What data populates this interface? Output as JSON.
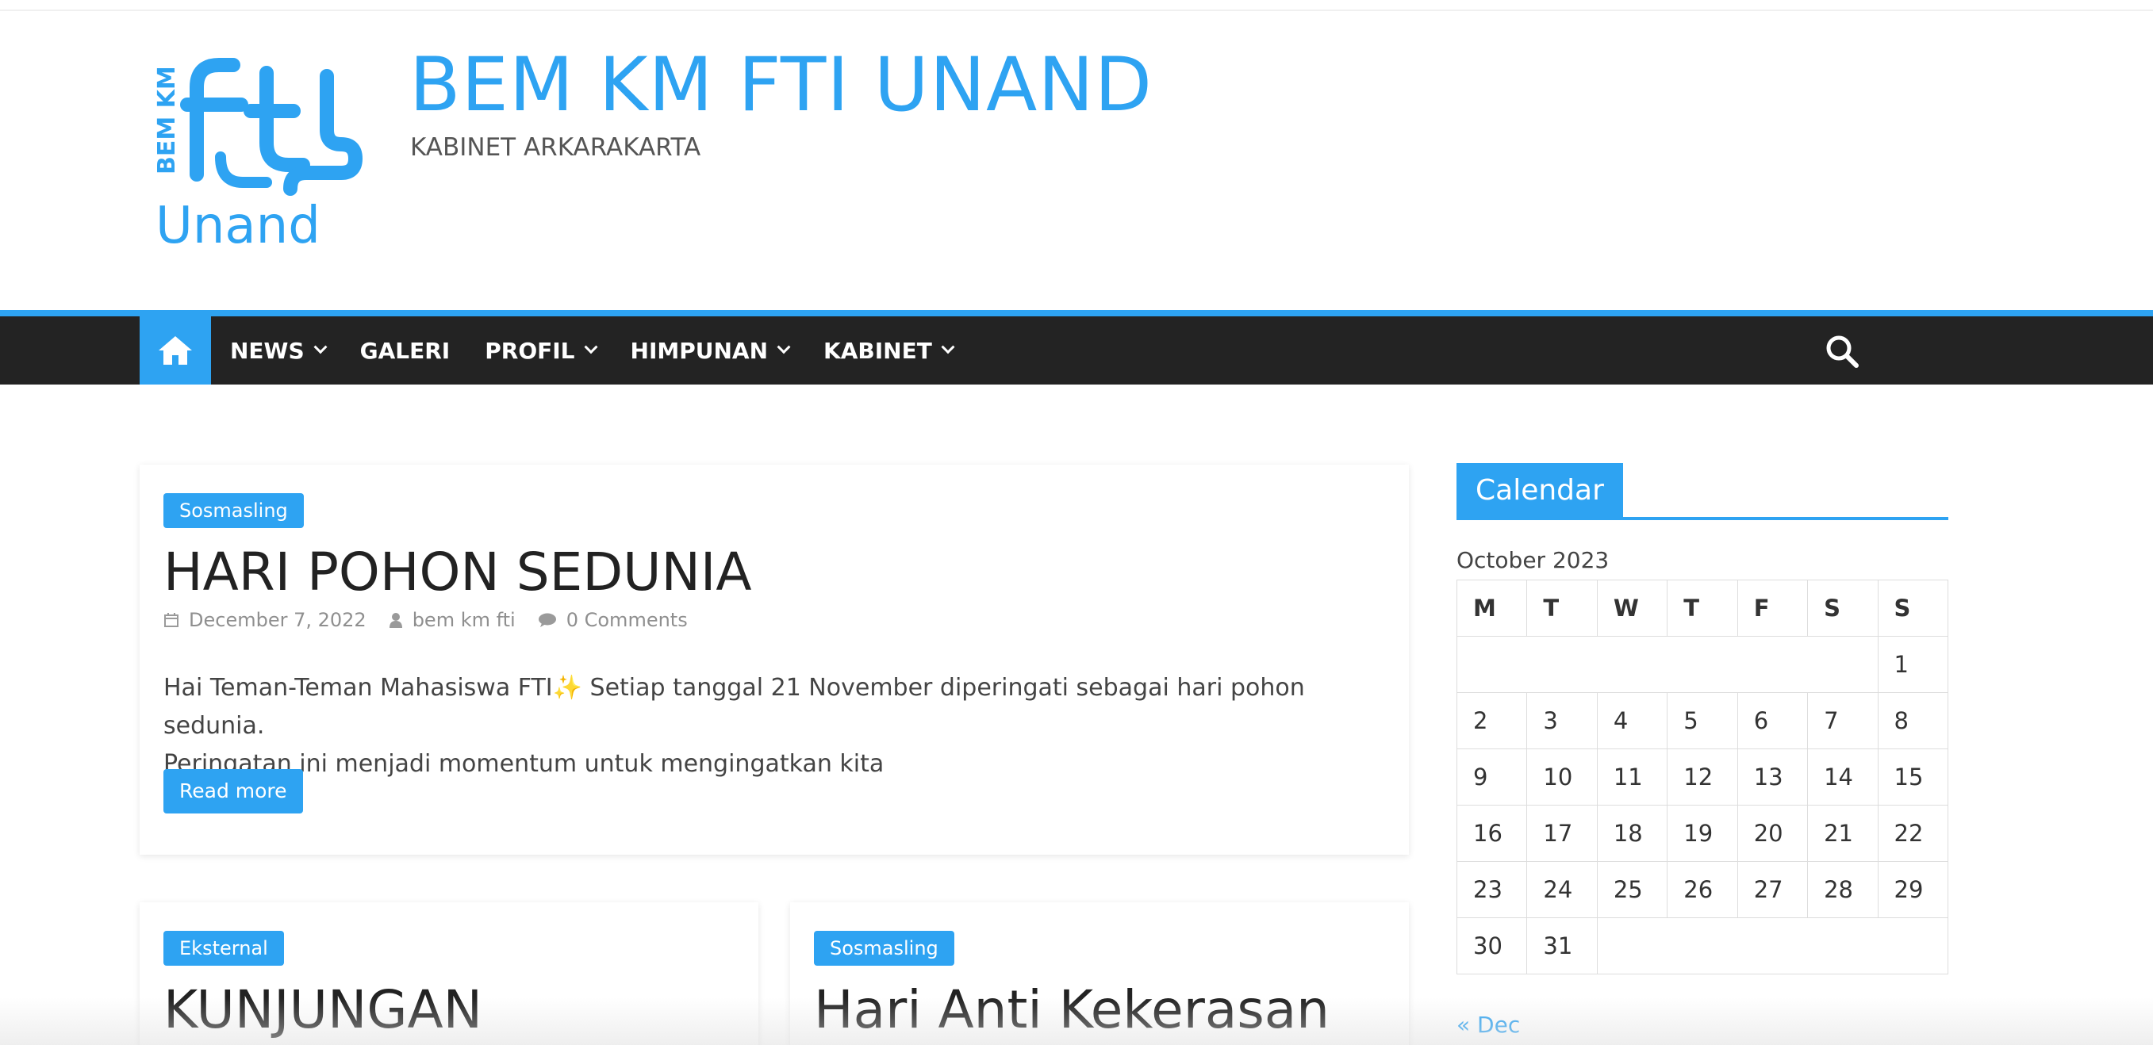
{
  "header": {
    "site_title": "BEM KM FTI UNAND",
    "site_description": "KABINET ARKARAKARTA",
    "logo_text_vertical": "BEM KM",
    "logo_text_main": "Unand"
  },
  "nav": {
    "items": [
      {
        "label": "NEWS",
        "has_dropdown": true
      },
      {
        "label": "GALERI",
        "has_dropdown": false
      },
      {
        "label": "PROFIL",
        "has_dropdown": true
      },
      {
        "label": "HIMPUNAN",
        "has_dropdown": true
      },
      {
        "label": "KABINET",
        "has_dropdown": true
      }
    ],
    "home_icon": "home-icon",
    "search_icon": "search-icon"
  },
  "featured_post": {
    "category": "Sosmasling",
    "title": "HARI POHON SEDUNIA",
    "date": "December 7, 2022",
    "author": "bem km fti",
    "comments": "0 Comments",
    "excerpt_line1": "Hai Teman-Teman Mahasiswa FTI✨ Setiap tanggal 21 November diperingati sebagai hari pohon sedunia.",
    "excerpt_line2": "Peringatan ini menjadi momentum untuk mengingatkan kita",
    "read_more": "Read more"
  },
  "posts": [
    {
      "category": "Eksternal",
      "title": "KUNJUNGAN"
    },
    {
      "category": "Sosmasling",
      "title": "Hari Anti Kekerasan"
    }
  ],
  "sidebar": {
    "widget_title": "Calendar",
    "calendar": {
      "caption": "October 2023",
      "weekdays": [
        "M",
        "T",
        "W",
        "T",
        "F",
        "S",
        "S"
      ],
      "weeks": [
        [
          "",
          "",
          "",
          "",
          "",
          "",
          "1"
        ],
        [
          "2",
          "3",
          "4",
          "5",
          "6",
          "7",
          "8"
        ],
        [
          "9",
          "10",
          "11",
          "12",
          "13",
          "14",
          "15"
        ],
        [
          "16",
          "17",
          "18",
          "19",
          "20",
          "21",
          "22"
        ],
        [
          "23",
          "24",
          "25",
          "26",
          "27",
          "28",
          "29"
        ],
        [
          "30",
          "31",
          "",
          "",
          "",
          "",
          ""
        ]
      ],
      "prev_link": "« Dec"
    }
  },
  "colors": {
    "accent": "#2ea3f2",
    "nav_bg": "#232323",
    "title_text": "#222222"
  }
}
